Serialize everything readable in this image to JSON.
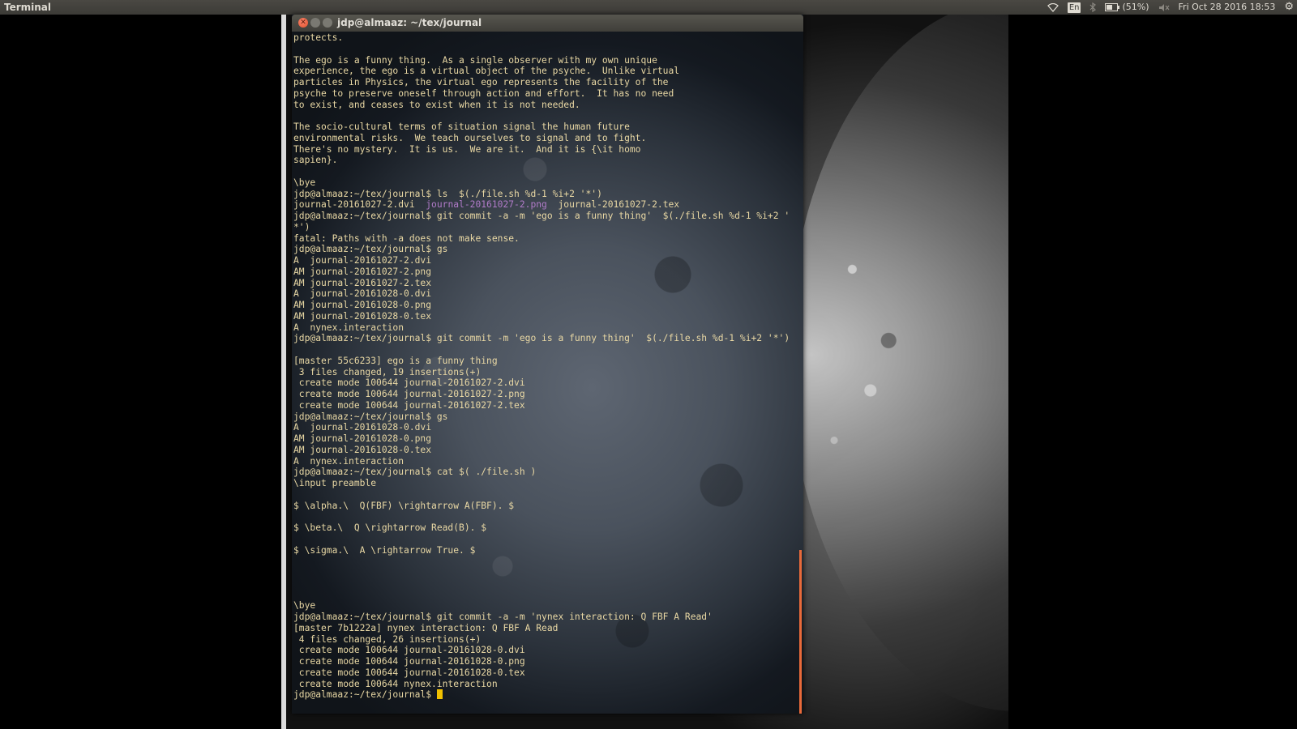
{
  "top_panel": {
    "app_name": "Terminal",
    "keyboard_layout": "En",
    "battery_percent": "(51%)",
    "clock": "Fri Oct 28 2016 18:53",
    "icons": [
      "wifi-icon",
      "keyboard-layout-indicator",
      "bluetooth-icon",
      "battery-icon",
      "volume-muted-icon",
      "settings-gear-icon"
    ]
  },
  "window": {
    "title": "jdp@almaaz: ~/tex/journal",
    "buttons": [
      "close",
      "minimize",
      "maximize"
    ]
  },
  "terminal": {
    "lines": [
      "protects.",
      "",
      "The ego is a funny thing.  As a single observer with my own unique",
      "experience, the ego is a virtual object of the psyche.  Unlike virtual",
      "particles in Physics, the virtual ego represents the facility of the",
      "psyche to preserve oneself through action and effort.  It has no need",
      "to exist, and ceases to exist when it is not needed.",
      "",
      "The socio-cultural terms of situation signal the human future",
      "environmental risks.  We teach ourselves to signal and to fight.",
      "There's no mystery.  It is us.  We are it.  And it is {\\it homo",
      "sapien}.",
      "",
      "\\bye",
      "jdp@almaaz:~/tex/journal$ ls  $(./file.sh %d-1 %i+2 '*')",
      "journal-20161027-2.dvi  journal-20161027-2.png  journal-20161027-2.tex",
      "jdp@almaaz:~/tex/journal$ git commit -a -m 'ego is a funny thing'  $(./file.sh %d-1 %i+2 '",
      "*')",
      "fatal: Paths with -a does not make sense.",
      "jdp@almaaz:~/tex/journal$ gs",
      "A  journal-20161027-2.dvi",
      "AM journal-20161027-2.png",
      "AM journal-20161027-2.tex",
      "A  journal-20161028-0.dvi",
      "AM journal-20161028-0.png",
      "AM journal-20161028-0.tex",
      "A  nynex.interaction",
      "jdp@almaaz:~/tex/journal$ git commit -m 'ego is a funny thing'  $(./file.sh %d-1 %i+2 '*')",
      "",
      "[master 55c6233] ego is a funny thing",
      " 3 files changed, 19 insertions(+)",
      " create mode 100644 journal-20161027-2.dvi",
      " create mode 100644 journal-20161027-2.png",
      " create mode 100644 journal-20161027-2.tex",
      "jdp@almaaz:~/tex/journal$ gs",
      "A  journal-20161028-0.dvi",
      "AM journal-20161028-0.png",
      "AM journal-20161028-0.tex",
      "A  nynex.interaction",
      "jdp@almaaz:~/tex/journal$ cat $( ./file.sh )",
      "\\input preamble",
      "",
      "$ \\alpha.\\  Q(FBF) \\rightarrow A(FBF). $",
      "",
      "$ \\beta.\\  Q \\rightarrow Read(B). $",
      "",
      "$ \\sigma.\\  A \\rightarrow True. $",
      "",
      "",
      "",
      "",
      "\\bye",
      "jdp@almaaz:~/tex/journal$ git commit -a -m 'nynex interaction: Q FBF A Read'",
      "[master 7b1222a] nynex interaction: Q FBF A Read",
      " 4 files changed, 26 insertions(+)",
      " create mode 100644 journal-20161028-0.dvi",
      " create mode 100644 journal-20161028-0.png",
      " create mode 100644 journal-20161028-0.tex",
      " create mode 100644 nynex.interaction"
    ],
    "ls_output": {
      "before": "journal-20161027-2.dvi  ",
      "highlighted": "journal-20161027-2.png",
      "after": "  journal-20161027-2.tex",
      "highlight_color": "#b17bc9"
    },
    "prompt": "jdp@almaaz:~/tex/journal$ ",
    "text_color": "#e9d8a4",
    "cursor_color": "#f0c000",
    "scrollbar_color": "#e96a3a"
  }
}
